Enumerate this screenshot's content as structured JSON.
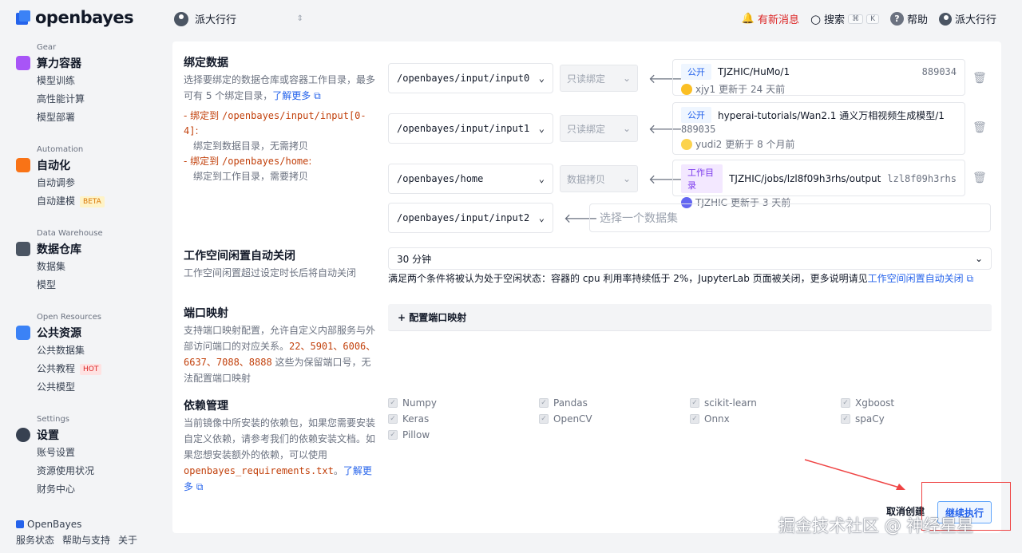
{
  "brand": {
    "name": "openbayes"
  },
  "topbar": {
    "workspace": "派大行行",
    "news": "有新消息",
    "search": "搜索",
    "kbd1": "⌘",
    "kbd2": "K",
    "help": "帮助",
    "user": "派大行行"
  },
  "sidebar": {
    "groups": [
      {
        "eyebrow": "Gear",
        "title": "算力容器",
        "color": "#a855f7",
        "items": [
          "模型训练",
          "高性能计算",
          "模型部署"
        ]
      },
      {
        "eyebrow": "Automation",
        "title": "自动化",
        "color": "#f97316",
        "items": [
          "自动调参",
          "自动建模"
        ],
        "badge": "BETA"
      },
      {
        "eyebrow": "Data Warehouse",
        "title": "数据仓库",
        "color": "#4b5563",
        "items": [
          "数据集",
          "模型"
        ]
      },
      {
        "eyebrow": "Open Resources",
        "title": "公共资源",
        "color": "#3b82f6",
        "items": [
          "公共数据集",
          "公共教程",
          "公共模型"
        ],
        "badge": "HOT"
      },
      {
        "eyebrow": "Settings",
        "title": "设置",
        "color": "#374151",
        "items": [
          "账号设置",
          "资源使用状况",
          "财务中心"
        ]
      }
    ],
    "footer": {
      "brand": "OpenBayes",
      "links": [
        "服务状态",
        "帮助与支持",
        "关于"
      ]
    }
  },
  "binding": {
    "title": "绑定数据",
    "desc": "选择要绑定的数据仓库或容器工作目录，最多可有 5 个绑定目录，",
    "learn_more": "了解更多",
    "bullet1_prefix": "绑定到",
    "bullet1_path": "/openbayes/input/input[0-4]",
    "bullet1_note": "绑定到数据目录，无需拷贝",
    "bullet2_prefix": "绑定到",
    "bullet2_path": "/openbayes/home",
    "bullet2_note": "绑定到工作目录，需要拷贝",
    "rows": [
      {
        "path": "/openbayes/input/input0",
        "mode": "只读绑定",
        "badge": "公开",
        "name": "TJZHIC/HuMo/1",
        "id": "889034",
        "user": "xjy1",
        "updated": "更新于 24 天前"
      },
      {
        "path": "/openbayes/input/input1",
        "mode": "只读绑定",
        "badge": "公开",
        "name": "hyperai-tutorials/Wan2.1 通义万相视频生成模型/1",
        "id": "889035",
        "user": "yudi2",
        "updated": "更新于 8 个月前"
      },
      {
        "path": "/openbayes/home",
        "mode": "数据拷贝",
        "badge": "工作目录",
        "name": "TJZHIC/jobs/lzl8f09h3rhs/output",
        "id": "lzl8f09h3rhs",
        "user": "TJZHIC",
        "updated": "更新于 3 天前"
      }
    ],
    "empty_path": "/openbayes/input/input2",
    "empty_placeholder": "选择一个数据集"
  },
  "idle": {
    "title": "工作空间闲置自动关闭",
    "desc": "工作空间闲置超过设定时长后将自动关闭",
    "value": "30 分钟",
    "note": "满足两个条件将被认为处于空闲状态：容器的 cpu 利用率持续低于 2%，JupyterLab 页面被关闭，更多说明请见",
    "note_link": "工作空间闲置自动关闭"
  },
  "port": {
    "title": "端口映射",
    "desc_a": "支持端口映射配置，允许自定义内部服务与外部访问端口的对应关系。",
    "ports": "22、5901、6006、6637、7088、8888",
    "desc_b": " 这些为保留端口号，无法配置端口映射",
    "button": "+ 配置端口映射"
  },
  "deps": {
    "title": "依赖管理",
    "desc": "当前镜像中所安装的依赖包，如果您需要安装自定义依赖，请参考我们的依赖安装文档。如果您想安装额外的依赖，可以使用",
    "file": "openbayes_requirements.txt",
    "sep": "。",
    "learn_more": "了解更多",
    "packages": [
      "Numpy",
      "Pandas",
      "scikit-learn",
      "Xgboost",
      "Keras",
      "OpenCV",
      "Onnx",
      "spaCy",
      "Pillow"
    ]
  },
  "actions": {
    "cancel": "取消创建",
    "continue": "继续执行"
  },
  "watermark": "掘金技术社区 @ 神经星星"
}
